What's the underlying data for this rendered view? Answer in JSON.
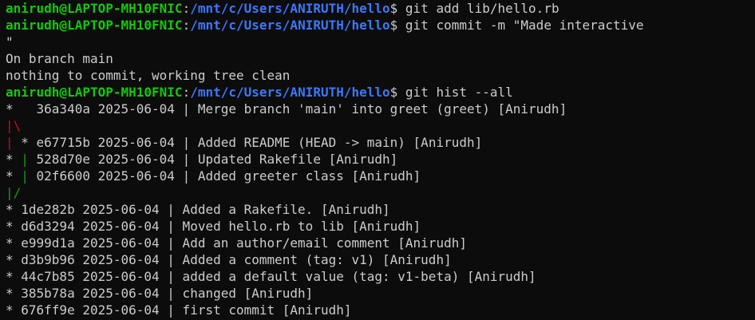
{
  "terminal": {
    "colors": {
      "background": "#0c0c0c",
      "foreground": "#cccccc",
      "user_host": "#16c60c",
      "path": "#3b78ff",
      "graph_red": "#c50f1f",
      "graph_green": "#13a10e"
    },
    "lines": [
      {
        "type": "prompt",
        "user": "anirudh@LAPTOP-MH10FNIC",
        "sep": ":",
        "path": "/mnt/c/Users/ANIRUTH/hello",
        "sym": "$ ",
        "cmd": "git add lib/hello.rb"
      },
      {
        "type": "prompt",
        "user": "anirudh@LAPTOP-MH10FNIC",
        "sep": ":",
        "path": "/mnt/c/Users/ANIRUTH/hello",
        "sym": "$ ",
        "cmd": "git commit -m \"Made interactive"
      },
      {
        "type": "output",
        "text": "\""
      },
      {
        "type": "output",
        "text": "On branch main"
      },
      {
        "type": "output",
        "text": "nothing to commit, working tree clean"
      },
      {
        "type": "prompt",
        "user": "anirudh@LAPTOP-MH10FNIC",
        "sep": ":",
        "path": "/mnt/c/Users/ANIRUTH/hello",
        "sym": "$ ",
        "cmd": "git hist --all"
      },
      {
        "type": "graph",
        "segments": [
          {
            "text": "*   36a340a 2025-06-04 | Merge branch 'main' into greet (greet) [Anirudh]",
            "color": "white"
          }
        ]
      },
      {
        "type": "graph",
        "segments": [
          {
            "text": "|\\",
            "color": "red"
          }
        ]
      },
      {
        "type": "graph",
        "segments": [
          {
            "text": "|",
            "color": "red"
          },
          {
            "text": " * e67715b 2025-06-04 | Added README (HEAD -> main) [Anirudh]",
            "color": "white"
          }
        ]
      },
      {
        "type": "graph",
        "segments": [
          {
            "text": "* ",
            "color": "white"
          },
          {
            "text": "|",
            "color": "green"
          },
          {
            "text": " 528d70e 2025-06-04 | Updated Rakefile [Anirudh]",
            "color": "white"
          }
        ]
      },
      {
        "type": "graph",
        "segments": [
          {
            "text": "* ",
            "color": "white"
          },
          {
            "text": "|",
            "color": "green"
          },
          {
            "text": " 02f6600 2025-06-04 | Added greeter class [Anirudh]",
            "color": "white"
          }
        ]
      },
      {
        "type": "graph",
        "segments": [
          {
            "text": "|/",
            "color": "green"
          }
        ]
      },
      {
        "type": "graph",
        "segments": [
          {
            "text": "* 1de282b 2025-06-04 | Added a Rakefile. [Anirudh]",
            "color": "white"
          }
        ]
      },
      {
        "type": "graph",
        "segments": [
          {
            "text": "* d6d3294 2025-06-04 | Moved hello.rb to lib [Anirudh]",
            "color": "white"
          }
        ]
      },
      {
        "type": "graph",
        "segments": [
          {
            "text": "* e999d1a 2025-06-04 | Add an author/email comment [Anirudh]",
            "color": "white"
          }
        ]
      },
      {
        "type": "graph",
        "segments": [
          {
            "text": "* d3b9b96 2025-06-04 | Added a comment (tag: v1) [Anirudh]",
            "color": "white"
          }
        ]
      },
      {
        "type": "graph",
        "segments": [
          {
            "text": "* 44c7b85 2025-06-04 | added a default value (tag: v1-beta) [Anirudh]",
            "color": "white"
          }
        ]
      },
      {
        "type": "graph",
        "segments": [
          {
            "text": "* 385b78a 2025-06-04 | changed [Anirudh]",
            "color": "white"
          }
        ]
      },
      {
        "type": "graph",
        "segments": [
          {
            "text": "* 676ff9e 2025-06-04 | first commit [Anirudh]",
            "color": "white"
          }
        ]
      }
    ]
  }
}
